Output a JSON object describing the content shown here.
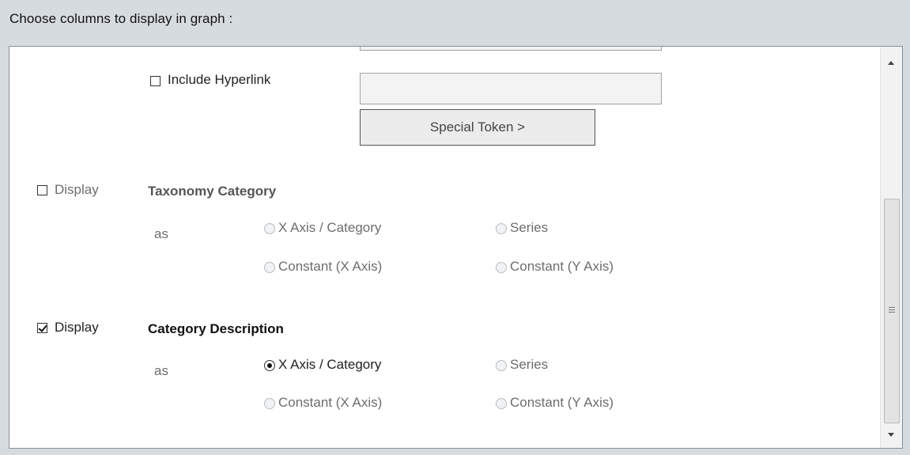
{
  "heading": "Choose columns to display in graph :",
  "hyperlink": {
    "checkbox_label": "Include Hyperlink",
    "checked": false,
    "input_value": "",
    "special_token_button": "Special Token >"
  },
  "sections": [
    {
      "display_label": "Display",
      "display_checked": false,
      "title": "Taxonomy Category",
      "as_label": "as",
      "options": [
        "X Axis / Category",
        "Series",
        "Constant (X Axis)",
        "Constant (Y Axis)"
      ],
      "selected": null,
      "enabled": false
    },
    {
      "display_label": "Display",
      "display_checked": true,
      "title": "Category Description",
      "as_label": "as",
      "options": [
        "X Axis / Category",
        "Series",
        "Constant (X Axis)",
        "Constant (Y Axis)"
      ],
      "selected": "X Axis / Category",
      "enabled": true
    }
  ]
}
